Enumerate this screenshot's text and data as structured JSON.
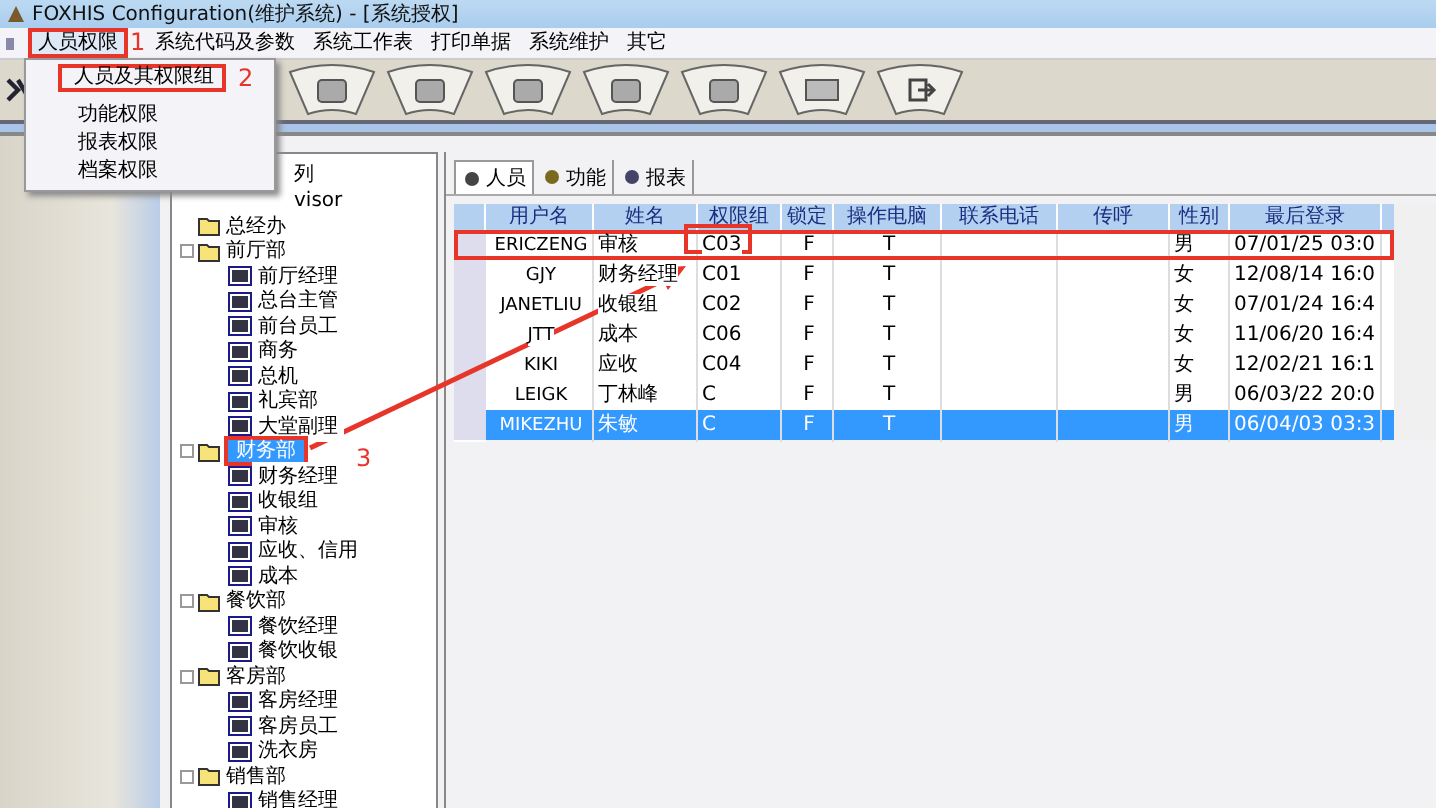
{
  "window": {
    "title": "FOXHIS Configuration(维护系统) - [系统授权]"
  },
  "menu_bar": [
    {
      "label": "人员权限",
      "selected": true,
      "outlined": true
    },
    {
      "label": "系统代码及参数",
      "selected": false,
      "outlined": false
    },
    {
      "label": "系统工作表",
      "selected": false,
      "outlined": false
    },
    {
      "label": "打印单据",
      "selected": false,
      "outlined": false
    },
    {
      "label": "系统维护",
      "selected": false,
      "outlined": false
    },
    {
      "label": "其它",
      "selected": false,
      "outlined": false
    }
  ],
  "dropdown_menu": [
    {
      "label": "人员及其权限组",
      "outlined": true
    },
    {
      "label": "功能权限",
      "outlined": false
    },
    {
      "label": "报表权限",
      "outlined": false
    },
    {
      "label": "档案权限",
      "outlined": false
    }
  ],
  "tree": [
    {
      "label": "列",
      "kind": "text"
    },
    {
      "label": "visor",
      "kind": "text"
    },
    {
      "label": "总经办",
      "kind": "folder",
      "selected": false,
      "outlined": false
    },
    {
      "label": "前厅部",
      "kind": "folder",
      "selected": false,
      "outlined": false,
      "children": [
        {
          "label": "前厅经理",
          "kind": "group"
        },
        {
          "label": "总台主管",
          "kind": "group"
        },
        {
          "label": "前台员工",
          "kind": "group"
        },
        {
          "label": "商务",
          "kind": "group"
        },
        {
          "label": "总机",
          "kind": "group"
        },
        {
          "label": "礼宾部",
          "kind": "group"
        },
        {
          "label": "大堂副理",
          "kind": "group"
        }
      ]
    },
    {
      "label": "财务部",
      "kind": "folder",
      "selected": true,
      "outlined": true,
      "children": [
        {
          "label": "财务经理",
          "kind": "group"
        },
        {
          "label": "收银组",
          "kind": "group"
        },
        {
          "label": "审核",
          "kind": "group"
        },
        {
          "label": "应收、信用",
          "kind": "group"
        },
        {
          "label": "成本",
          "kind": "group"
        }
      ]
    },
    {
      "label": "餐饮部",
      "kind": "folder",
      "selected": false,
      "outlined": false,
      "children": [
        {
          "label": "餐饮经理",
          "kind": "group"
        },
        {
          "label": "餐饮收银",
          "kind": "group"
        }
      ]
    },
    {
      "label": "客房部",
      "kind": "folder",
      "selected": false,
      "outlined": false,
      "children": [
        {
          "label": "客房经理",
          "kind": "group"
        },
        {
          "label": "客房员工",
          "kind": "group"
        },
        {
          "label": "洗衣房",
          "kind": "group"
        }
      ]
    },
    {
      "label": "销售部",
      "kind": "folder",
      "selected": false,
      "outlined": false,
      "children": [
        {
          "label": "销售经理",
          "kind": "group"
        }
      ]
    }
  ],
  "tabs": [
    {
      "label": "人员",
      "selected": true
    },
    {
      "label": "功能",
      "selected": false
    },
    {
      "label": "报表",
      "selected": false
    }
  ],
  "table": {
    "columns": [
      "用户名",
      "姓名",
      "权限组",
      "锁定",
      "操作电脑",
      "联系电话",
      "传呼",
      "性别",
      "最后登录"
    ],
    "rows": [
      {
        "selected": false,
        "outlined": true,
        "cells": [
          "ERICZENG",
          "审核",
          "C03",
          "F",
          "T",
          "",
          "",
          "男",
          "07/01/25 03:0"
        ]
      },
      {
        "selected": false,
        "outlined": false,
        "cells": [
          "GJY",
          "财务经理",
          "C01",
          "F",
          "T",
          "",
          "",
          "女",
          "12/08/14 16:0"
        ]
      },
      {
        "selected": false,
        "outlined": false,
        "cells": [
          "JANETLIU",
          "收银组",
          "C02",
          "F",
          "T",
          "",
          "",
          "女",
          "07/01/24 16:4"
        ]
      },
      {
        "selected": false,
        "outlined": false,
        "cells": [
          "JTT",
          "成本",
          "C06",
          "F",
          "T",
          "",
          "",
          "女",
          "11/06/20 16:4"
        ]
      },
      {
        "selected": false,
        "outlined": false,
        "cells": [
          "KIKI",
          "应收",
          "C04",
          "F",
          "T",
          "",
          "",
          "女",
          "12/02/21 16:1"
        ]
      },
      {
        "selected": false,
        "outlined": false,
        "cells": [
          "LEIGK",
          "丁林峰",
          "C",
          "F",
          "T",
          "",
          "",
          "男",
          "06/03/22 20:0"
        ]
      },
      {
        "selected": true,
        "outlined": false,
        "cells": [
          "MIKEZHU",
          "朱敏",
          "C",
          "F",
          "T",
          "",
          "",
          "男",
          "06/04/03 03:3"
        ]
      }
    ]
  },
  "annotations": [
    {
      "label": "1"
    },
    {
      "label": "2"
    },
    {
      "label": "3"
    }
  ]
}
